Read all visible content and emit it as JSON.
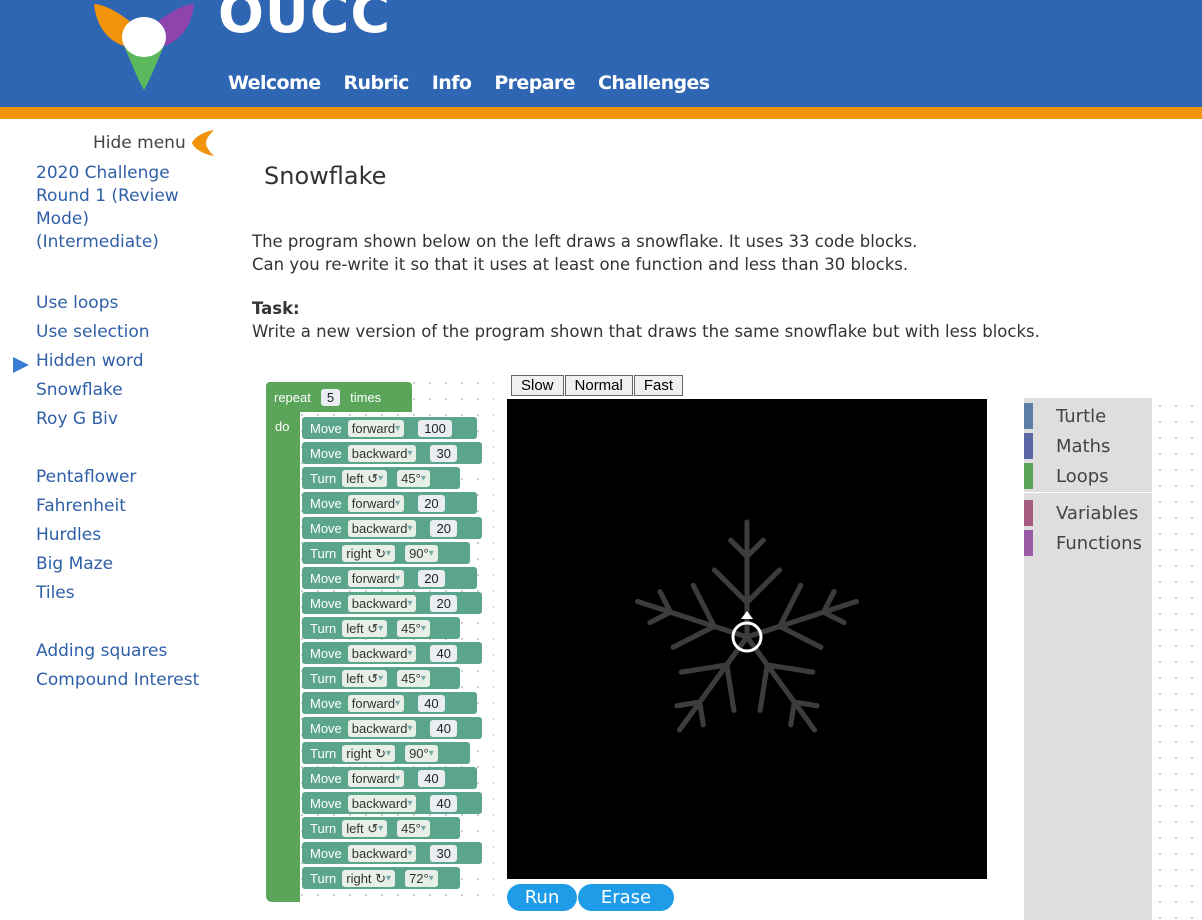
{
  "header": {
    "brand": "OUCC",
    "nav": [
      "Welcome",
      "Rubric",
      "Info",
      "Prepare",
      "Challenges"
    ],
    "color": "#2f66b3",
    "stripe_color": "#f2940b"
  },
  "sidebar": {
    "hide_menu_label": "Hide menu",
    "course_title": "2020 Challenge Round 1 (Review Mode) (Intermediate)",
    "groups": [
      [
        "Use loops",
        "Use selection",
        "Hidden word",
        "Snowflake",
        "Roy G Biv"
      ],
      [
        "Pentaflower",
        "Fahrenheit",
        "Hurdles",
        "Big Maze",
        "Tiles"
      ],
      [
        "Adding squares",
        "Compound Interest"
      ]
    ],
    "active_item": "Snowflake"
  },
  "main": {
    "title": "Snowflake",
    "description_line1": "The program shown below on the left draws a snowflake. It uses 33 code blocks.",
    "description_line2": "Can you re-write it so that it uses at least one function and less than 30 blocks.",
    "task_label": "Task:",
    "task_text": "Write a new version of the program shown that draws the same snowflake but with less blocks."
  },
  "program": {
    "repeat_label": "repeat",
    "repeat_count": "5",
    "times_label": "times",
    "do_label": "do",
    "blocks": [
      {
        "type": "move",
        "label": "Move",
        "dir": "forward",
        "value": "100"
      },
      {
        "type": "move",
        "label": "Move",
        "dir": "backward",
        "value": "30"
      },
      {
        "type": "turn",
        "label": "Turn",
        "dir": "left ↺",
        "value": "45°"
      },
      {
        "type": "move",
        "label": "Move",
        "dir": "forward",
        "value": "20"
      },
      {
        "type": "move",
        "label": "Move",
        "dir": "backward",
        "value": "20"
      },
      {
        "type": "turn",
        "label": "Turn",
        "dir": "right ↻",
        "value": "90°"
      },
      {
        "type": "move",
        "label": "Move",
        "dir": "forward",
        "value": "20"
      },
      {
        "type": "move",
        "label": "Move",
        "dir": "backward",
        "value": "20"
      },
      {
        "type": "turn",
        "label": "Turn",
        "dir": "left ↺",
        "value": "45°"
      },
      {
        "type": "move",
        "label": "Move",
        "dir": "backward",
        "value": "40"
      },
      {
        "type": "turn",
        "label": "Turn",
        "dir": "left ↺",
        "value": "45°"
      },
      {
        "type": "move",
        "label": "Move",
        "dir": "forward",
        "value": "40"
      },
      {
        "type": "move",
        "label": "Move",
        "dir": "backward",
        "value": "40"
      },
      {
        "type": "turn",
        "label": "Turn",
        "dir": "right ↻",
        "value": "90°"
      },
      {
        "type": "move",
        "label": "Move",
        "dir": "forward",
        "value": "40"
      },
      {
        "type": "move",
        "label": "Move",
        "dir": "backward",
        "value": "40"
      },
      {
        "type": "turn",
        "label": "Turn",
        "dir": "left ↺",
        "value": "45°"
      },
      {
        "type": "move",
        "label": "Move",
        "dir": "backward",
        "value": "30"
      },
      {
        "type": "turn",
        "label": "Turn",
        "dir": "right ↻",
        "value": "72°"
      }
    ],
    "loop_color": "#5ba55b",
    "move_color": "#5ba58c",
    "turn_color": "#5ba58c"
  },
  "controls": {
    "speeds": [
      "Slow",
      "Normal",
      "Fast"
    ],
    "run_label": "Run",
    "erase_label": "Erase"
  },
  "toolbox": {
    "categories": [
      {
        "name": "Turtle",
        "color": "#5b80a5"
      },
      {
        "name": "Maths",
        "color": "#5b67a5"
      },
      {
        "name": "Loops",
        "color": "#5ba55b"
      },
      {
        "name": "Variables",
        "color": "#a55b80"
      },
      {
        "name": "Functions",
        "color": "#995ba5"
      }
    ]
  }
}
